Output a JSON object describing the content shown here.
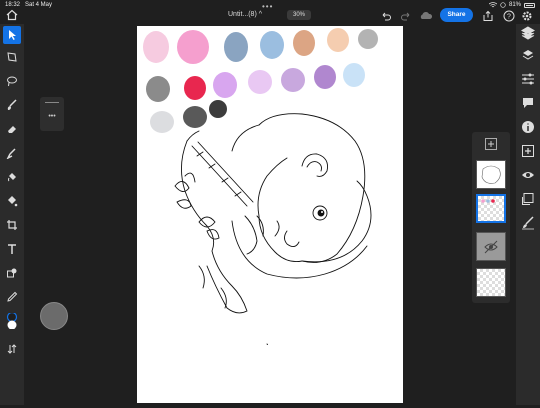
{
  "status": {
    "time": "18:32",
    "date": "Sat 4 May",
    "battery": "81%"
  },
  "header": {
    "title": "Untit...(8)",
    "title_chevron": "^",
    "zoom": "30%",
    "share_label": "Share",
    "multitask_dots": "•••"
  },
  "left_tools": [
    "select-arrow-icon",
    "lasso-transform-icon",
    "lasso-icon",
    "paint-brush-icon",
    "eraser-icon",
    "smudge-icon",
    "paint-bucket-icon",
    "fill-icon",
    "crop-icon",
    "text-icon",
    "shape-icon",
    "eyedropper-icon",
    "color-swatch-icon",
    "swap-icon"
  ],
  "right_tools": [
    "layers-icon",
    "layer-stack-icon",
    "adjustments-icon",
    "comment-icon",
    "info-icon",
    "add-layer-icon",
    "visibility-icon",
    "mask-icon",
    "brush-settings-icon"
  ],
  "slider_panel": {
    "dots": "•••"
  },
  "swatches": [
    {
      "color": "#f6cbe0"
    },
    {
      "color": "#f59fce"
    },
    {
      "color": "#8aa4c1"
    },
    {
      "color": "#9bbee0"
    },
    {
      "color": "#dca584"
    },
    {
      "color": "#f5cdb0"
    },
    {
      "color": "#b3b3b3"
    },
    {
      "color": "#8b8b8b"
    },
    {
      "color": "#e8274f"
    },
    {
      "color": "#d8a6ef"
    },
    {
      "color": "#e9c8f3"
    },
    {
      "color": "#c8a8de"
    },
    {
      "color": "#b087cf"
    },
    {
      "color": "#c9e2f7"
    },
    {
      "color": "#dcdde0"
    },
    {
      "color": "#595959"
    },
    {
      "color": "#3c3c3c"
    }
  ],
  "colors": {
    "accent": "#1473e6",
    "toolbar": "#2b2b2b",
    "workspace": "#1f1f1f"
  },
  "layers": {
    "add_label": "+",
    "count": 4,
    "selected_index": 1
  }
}
